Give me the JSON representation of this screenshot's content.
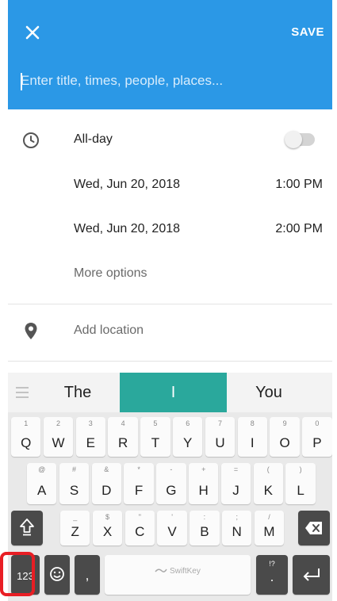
{
  "header": {
    "close_icon": "close-icon",
    "save_label": "SAVE",
    "title_placeholder": "Enter title, times, people, places..."
  },
  "form": {
    "all_day_label": "All-day",
    "all_day_on": false,
    "start": {
      "date": "Wed, Jun 20, 2018",
      "time": "1:00 PM"
    },
    "end": {
      "date": "Wed, Jun 20, 2018",
      "time": "2:00 PM"
    },
    "more_options": "More options",
    "location_placeholder": "Add location"
  },
  "keyboard": {
    "suggestions": [
      "The",
      "I",
      "You"
    ],
    "row1": [
      {
        "main": "Q",
        "sub": "1"
      },
      {
        "main": "W",
        "sub": "2"
      },
      {
        "main": "E",
        "sub": "3"
      },
      {
        "main": "R",
        "sub": "4"
      },
      {
        "main": "T",
        "sub": "5"
      },
      {
        "main": "Y",
        "sub": "6"
      },
      {
        "main": "U",
        "sub": "7"
      },
      {
        "main": "I",
        "sub": "8"
      },
      {
        "main": "O",
        "sub": "9"
      },
      {
        "main": "P",
        "sub": "0"
      }
    ],
    "row2": [
      {
        "main": "A",
        "sub": "@"
      },
      {
        "main": "S",
        "sub": "#"
      },
      {
        "main": "D",
        "sub": "&"
      },
      {
        "main": "F",
        "sub": "*"
      },
      {
        "main": "G",
        "sub": "-"
      },
      {
        "main": "H",
        "sub": "+"
      },
      {
        "main": "J",
        "sub": "="
      },
      {
        "main": "K",
        "sub": "("
      },
      {
        "main": "L",
        "sub": ")"
      }
    ],
    "row3": [
      {
        "main": "Z",
        "sub": "_"
      },
      {
        "main": "X",
        "sub": "$"
      },
      {
        "main": "C",
        "sub": "\""
      },
      {
        "main": "V",
        "sub": "'"
      },
      {
        "main": "B",
        "sub": ":"
      },
      {
        "main": "N",
        "sub": ";"
      },
      {
        "main": "M",
        "sub": "/"
      }
    ],
    "num_key": "123",
    "comma_key": ",",
    "space_label": "SwiftKey",
    "period_key": ".",
    "period_sub": "!?"
  }
}
